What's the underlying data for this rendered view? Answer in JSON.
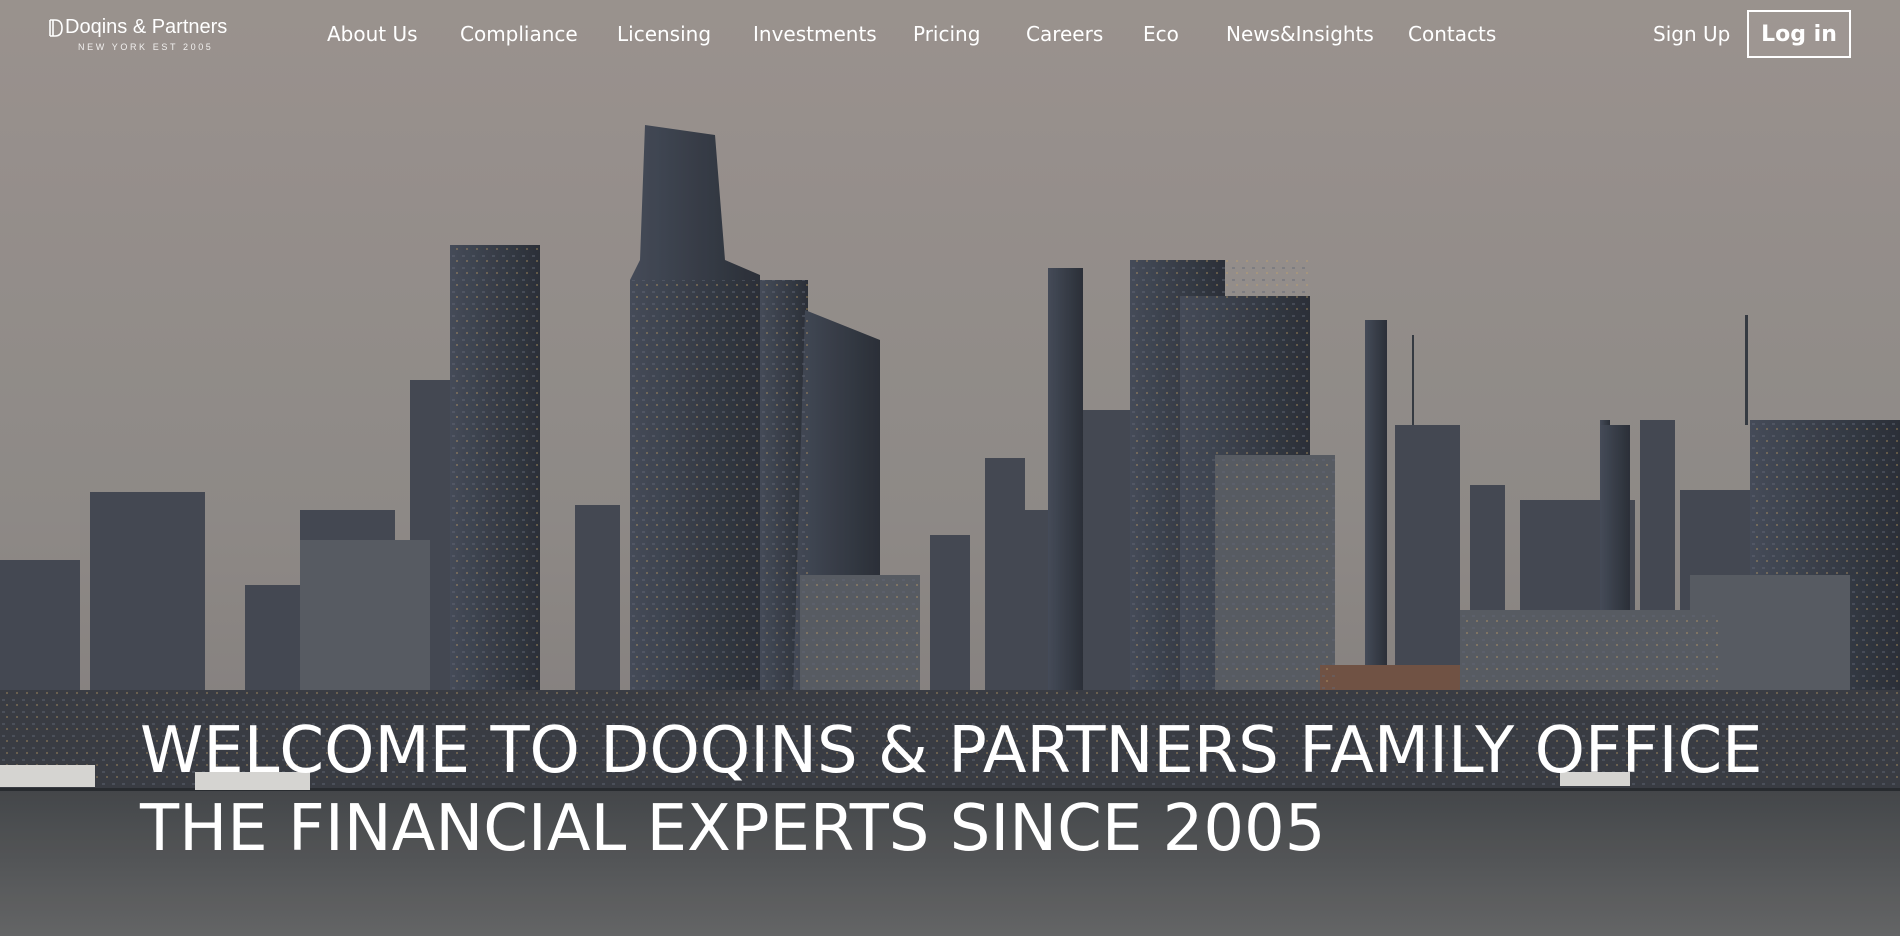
{
  "brand": {
    "name": "Doqins & Partners",
    "tagline": "NEW YORK EST 2005"
  },
  "nav": {
    "links": [
      "About Us",
      "Compliance",
      "Licensing",
      "Investments",
      "Pricing",
      "Careers",
      "Eco",
      "News&Insights",
      "Contacts"
    ],
    "sign_up": "Sign Up",
    "log_in": "Log in"
  },
  "hero": {
    "line1": "WELCOME TO DOQINS & PARTNERS FAMILY OFFICE",
    "line2": "THE FINANCIAL EXPERTS SINCE 2005",
    "background": "new-york-skyline-photo"
  },
  "colors": {
    "sky_top": "#aaa29d",
    "sky_bottom": "#8c8784",
    "buildings": "#3b3f47",
    "water": "#5d5f60",
    "text": "#ffffff"
  }
}
